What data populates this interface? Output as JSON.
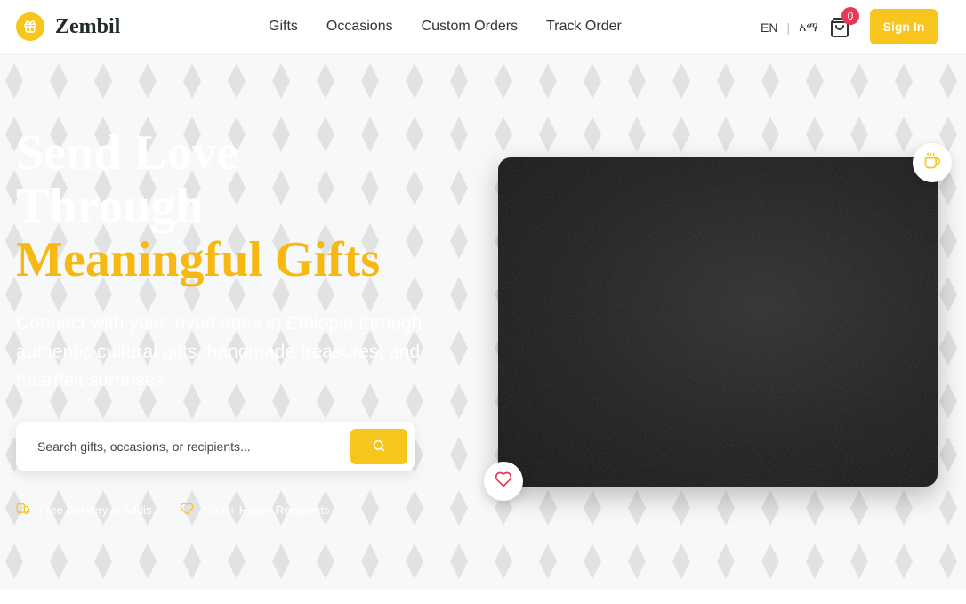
{
  "brand": {
    "name": "Zembil",
    "logo_icon": "gift-icon"
  },
  "nav": {
    "items": [
      {
        "label": "Gifts"
      },
      {
        "label": "Occasions"
      },
      {
        "label": "Custom Orders"
      },
      {
        "label": "Track Order"
      }
    ],
    "lang_en": "EN",
    "lang_separator": "|",
    "lang_am": "አማ",
    "cart_count": "0",
    "signin_label": "Sign In"
  },
  "hero": {
    "headline_line1": "Send Love",
    "headline_line2": "Through",
    "headline_highlight": "Meaningful Gifts",
    "subtitle": "Connect with your loved ones in Ethiopia through authentic cultural gifts, handmade treasures, and heartfelt surprises",
    "search_placeholder": "Search gifts, occasions, or recipients...",
    "features": [
      {
        "icon": "truck-icon",
        "label": "Free Delivery in Addis"
      },
      {
        "icon": "heart-icon",
        "label": "1000+ Happy Recipients"
      }
    ]
  },
  "colors": {
    "accent": "#f8c51c",
    "headline_gold": "#f6b811",
    "badge": "#e53955",
    "heart": "#e53955"
  }
}
